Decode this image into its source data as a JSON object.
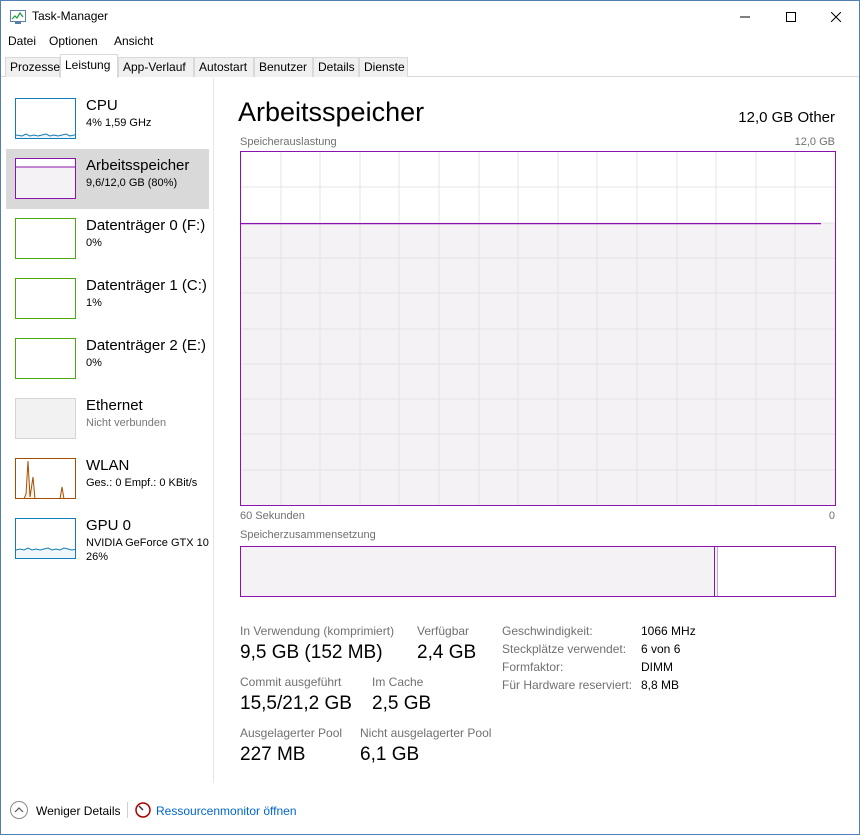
{
  "window": {
    "title": "Task-Manager"
  },
  "menu": [
    "Datei",
    "Optionen",
    "Ansicht"
  ],
  "tabs": [
    "Prozesse",
    "Leistung",
    "App-Verlauf",
    "Autostart",
    "Benutzer",
    "Details",
    "Dienste"
  ],
  "active_tab": "Leistung",
  "sidebar": {
    "items": [
      {
        "title": "CPU",
        "sub1": "4%  1,59 GHz",
        "sub2": "",
        "color": "#117dbb",
        "selected": false
      },
      {
        "title": "Arbeitsspeicher",
        "sub1": "9,6/12,0 GB (80%)",
        "sub2": "",
        "color": "#8b12ae",
        "selected": true
      },
      {
        "title": "Datenträger 0 (F:)",
        "sub1": "0%",
        "sub2": "",
        "color": "#4da60c",
        "selected": false
      },
      {
        "title": "Datenträger 1 (C:)",
        "sub1": "1%",
        "sub2": "",
        "color": "#4da60c",
        "selected": false
      },
      {
        "title": "Datenträger 2 (E:)",
        "sub1": "0%",
        "sub2": "",
        "color": "#4da60c",
        "selected": false
      },
      {
        "title": "Ethernet",
        "sub1": "Nicht verbunden",
        "sub2": "",
        "color": "#bdbdbd",
        "selected": false
      },
      {
        "title": "WLAN",
        "sub1": "Ges.: 0 Empf.: 0 KBit/s",
        "sub2": "",
        "color": "#a74f01",
        "selected": false
      },
      {
        "title": "GPU 0",
        "sub1": "NVIDIA GeForce GTX 10",
        "sub2": "26%",
        "color": "#117dbb",
        "selected": false
      }
    ]
  },
  "main": {
    "title": "Arbeitsspeicher",
    "total": "12,0 GB Other",
    "graph_label": "Speicherauslastung",
    "graph_max": "12,0 GB",
    "time_left": "60 Sekunden",
    "time_right": "0",
    "composition_label": "Speicherzusammensetzung",
    "usage_fraction": 0.8,
    "stats": [
      {
        "label": "In Verwendung (komprimiert)",
        "value": "9,5 GB (152 MB)"
      },
      {
        "label": "Verfügbar",
        "value": "2,4 GB"
      },
      {
        "label": "Commit ausgeführt",
        "value": "15,5/21,2 GB"
      },
      {
        "label": "Im Cache",
        "value": "2,5 GB"
      },
      {
        "label": "Ausgelagerter Pool",
        "value": "227 MB"
      },
      {
        "label": "Nicht ausgelagerter Pool",
        "value": "6,1 GB"
      }
    ],
    "details": [
      {
        "key": "Geschwindigkeit:",
        "value": "1066 MHz"
      },
      {
        "key": "Steckplätze verwendet:",
        "value": "6 von 6"
      },
      {
        "key": "Formfaktor:",
        "value": "DIMM"
      },
      {
        "key": "Für Hardware reserviert:",
        "value": "8,8 MB"
      }
    ]
  },
  "footer": {
    "fewer_details": "Weniger Details",
    "resource_monitor": "Ressourcenmonitor öffnen"
  },
  "colors": {
    "memory": "#8b12ae",
    "memory_fill": "#f4f2f4",
    "link": "#0066cc"
  }
}
